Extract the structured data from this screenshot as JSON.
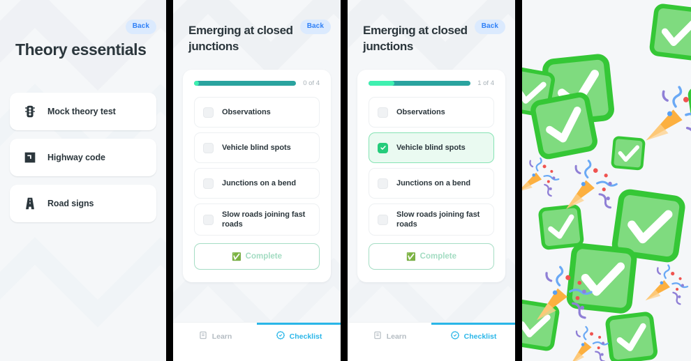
{
  "panels": [
    {
      "id": "theory-essentials",
      "back_label": "Back",
      "title": "Theory essentials",
      "menu": [
        {
          "label": "Mock theory test",
          "icon": "traffic-light-icon"
        },
        {
          "label": "Highway code",
          "icon": "book-icon"
        },
        {
          "label": "Road signs",
          "icon": "road-icon"
        }
      ]
    },
    {
      "id": "checklist-empty",
      "back_label": "Back",
      "title": "Emerging at closed junctions",
      "progress": {
        "text": "0 of 4",
        "completed": 0,
        "total": 4,
        "percent": 5
      },
      "tasks": [
        {
          "label": "Observations",
          "checked": false
        },
        {
          "label": "Vehicle blind spots",
          "checked": false
        },
        {
          "label": "Junctions on a bend",
          "checked": false
        },
        {
          "label": "Slow roads joining fast roads",
          "checked": false
        }
      ],
      "complete_label": "Complete",
      "complete_emoji": "✅",
      "tabs": [
        {
          "label": "Learn",
          "icon": "book-icon",
          "active": false
        },
        {
          "label": "Checklist",
          "icon": "badge-check-icon",
          "active": true
        }
      ]
    },
    {
      "id": "checklist-one-done",
      "back_label": "Back",
      "title": "Emerging at closed junctions",
      "progress": {
        "text": "1 of 4",
        "completed": 1,
        "total": 4,
        "percent": 25
      },
      "tasks": [
        {
          "label": "Observations",
          "checked": false
        },
        {
          "label": "Vehicle blind spots",
          "checked": true
        },
        {
          "label": "Junctions on a bend",
          "checked": false
        },
        {
          "label": "Slow roads joining fast roads",
          "checked": false
        }
      ],
      "complete_label": "Complete",
      "complete_emoji": "✅",
      "tabs": [
        {
          "label": "Learn",
          "icon": "book-icon",
          "active": false
        },
        {
          "label": "Checklist",
          "icon": "badge-check-icon",
          "active": true
        }
      ]
    },
    {
      "id": "celebration",
      "description": "Confetti celebration screen of green check-mark emoji and party popper emoji"
    }
  ],
  "colors": {
    "background": "#f5f7f9",
    "text_dark": "#2b363c",
    "accent_blue": "#2f80f7",
    "back_pill_bg": "#dbeafe",
    "progress_track": "#2aa39f",
    "progress_fill": "#3ff0b0",
    "check_green": "#25cc7b",
    "done_row_bg": "#eafaf1",
    "done_row_border": "#86e3b4",
    "complete_border": "#a5ddc4",
    "complete_text": "#a3dcc2",
    "tab_active": "#2ab6e8",
    "tab_inactive": "#b4bcc2",
    "divider": "#000000"
  }
}
